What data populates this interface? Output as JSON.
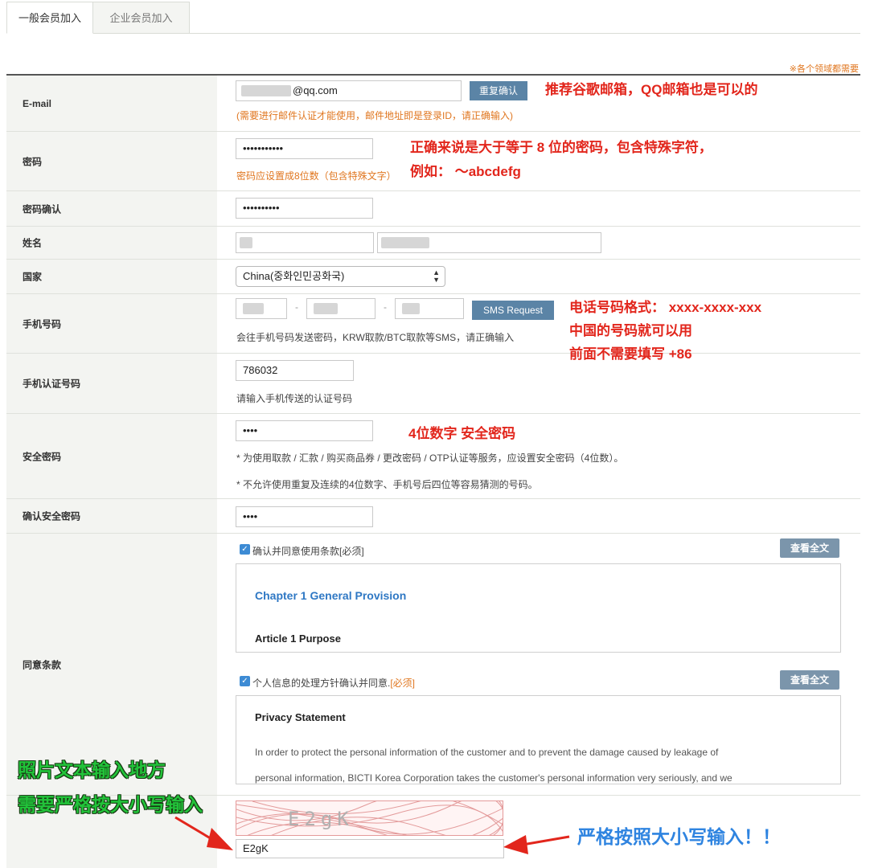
{
  "tabs": [
    "一般会员加入",
    "企业会员加入"
  ],
  "required_note": "※各个领域都需要",
  "email": {
    "label": "E-mail",
    "value_suffix": "@qq.com",
    "button": "重复确认",
    "hint": "(需要进行邮件认证才能使用，邮件地址即是登录ID，请正确输入)",
    "annotation": "推荐谷歌邮箱，QQ邮箱也是可以的"
  },
  "password": {
    "label": "密码",
    "value": "•••••••••••",
    "hint": "密码应设置成8位数（包含特殊文字）",
    "annotation_line1": "正确来说是大于等于 8 位的密码，包含特殊字符，",
    "annotation_line2": "例如： ～abcdefg"
  },
  "password_confirm": {
    "label": "密码确认",
    "value": "••••••••••"
  },
  "name": {
    "label": "姓名"
  },
  "country": {
    "label": "国家",
    "selected": "China(중화인민공화국)"
  },
  "phone": {
    "label": "手机号码",
    "button": "SMS Request",
    "hint": "会往手机号码发送密码，KRW取款/BTC取款等SMS，请正确输入",
    "annotation_line1": "电话号码格式： xxxx-xxxx-xxx",
    "annotation_line2": "中国的号码就可以用",
    "annotation_line3": "前面不需要填写 +86"
  },
  "phone_code": {
    "label": "手机认证号码",
    "value": "786032",
    "hint": "请输入手机传送的认证号码"
  },
  "security_pin": {
    "label": "安全密码",
    "value": "••••",
    "annotation": "4位数字 安全密码",
    "note1": "* 为使用取款 / 汇款 / 购买商品券 / 更改密码 / OTP认证等服务，应设置安全密码（4位数）。",
    "note2": "* 不允许使用重复及连续的4位数字、手机号后四位等容易猜测的号码。"
  },
  "security_pin_confirm": {
    "label": "确认安全密码",
    "value": "••••"
  },
  "terms": {
    "label": "同意条款",
    "agree1": "确认并同意使用条款[必须]",
    "view_button": "查看全文",
    "chapter": "Chapter 1 General Provision",
    "article": "Article 1 Purpose",
    "agree2_text": "个人信息的处理方针确认并同意.",
    "agree2_required": "[必须]",
    "privacy_title": "Privacy Statement",
    "privacy_line1": "In order to protect the personal information of the customer and to prevent the damage caused by leakage of",
    "privacy_line2": "personal information, BICTI Korea Corporation takes the customer's personal information very seriously, and we"
  },
  "captcha": {
    "image_text": "E2gK",
    "value": "E2gK",
    "annotation_left_line1": "照片文本输入地方",
    "annotation_left_line2": "需要严格按大小写输入",
    "annotation_right": "严格按照大小写输入！！"
  },
  "colors": {
    "annotation_red": "#e2261c",
    "annotation_blue": "#2f84e0",
    "annotation_green": "#22c33a",
    "hint_orange": "#e0761f",
    "button_blue": "#5b84a6"
  }
}
